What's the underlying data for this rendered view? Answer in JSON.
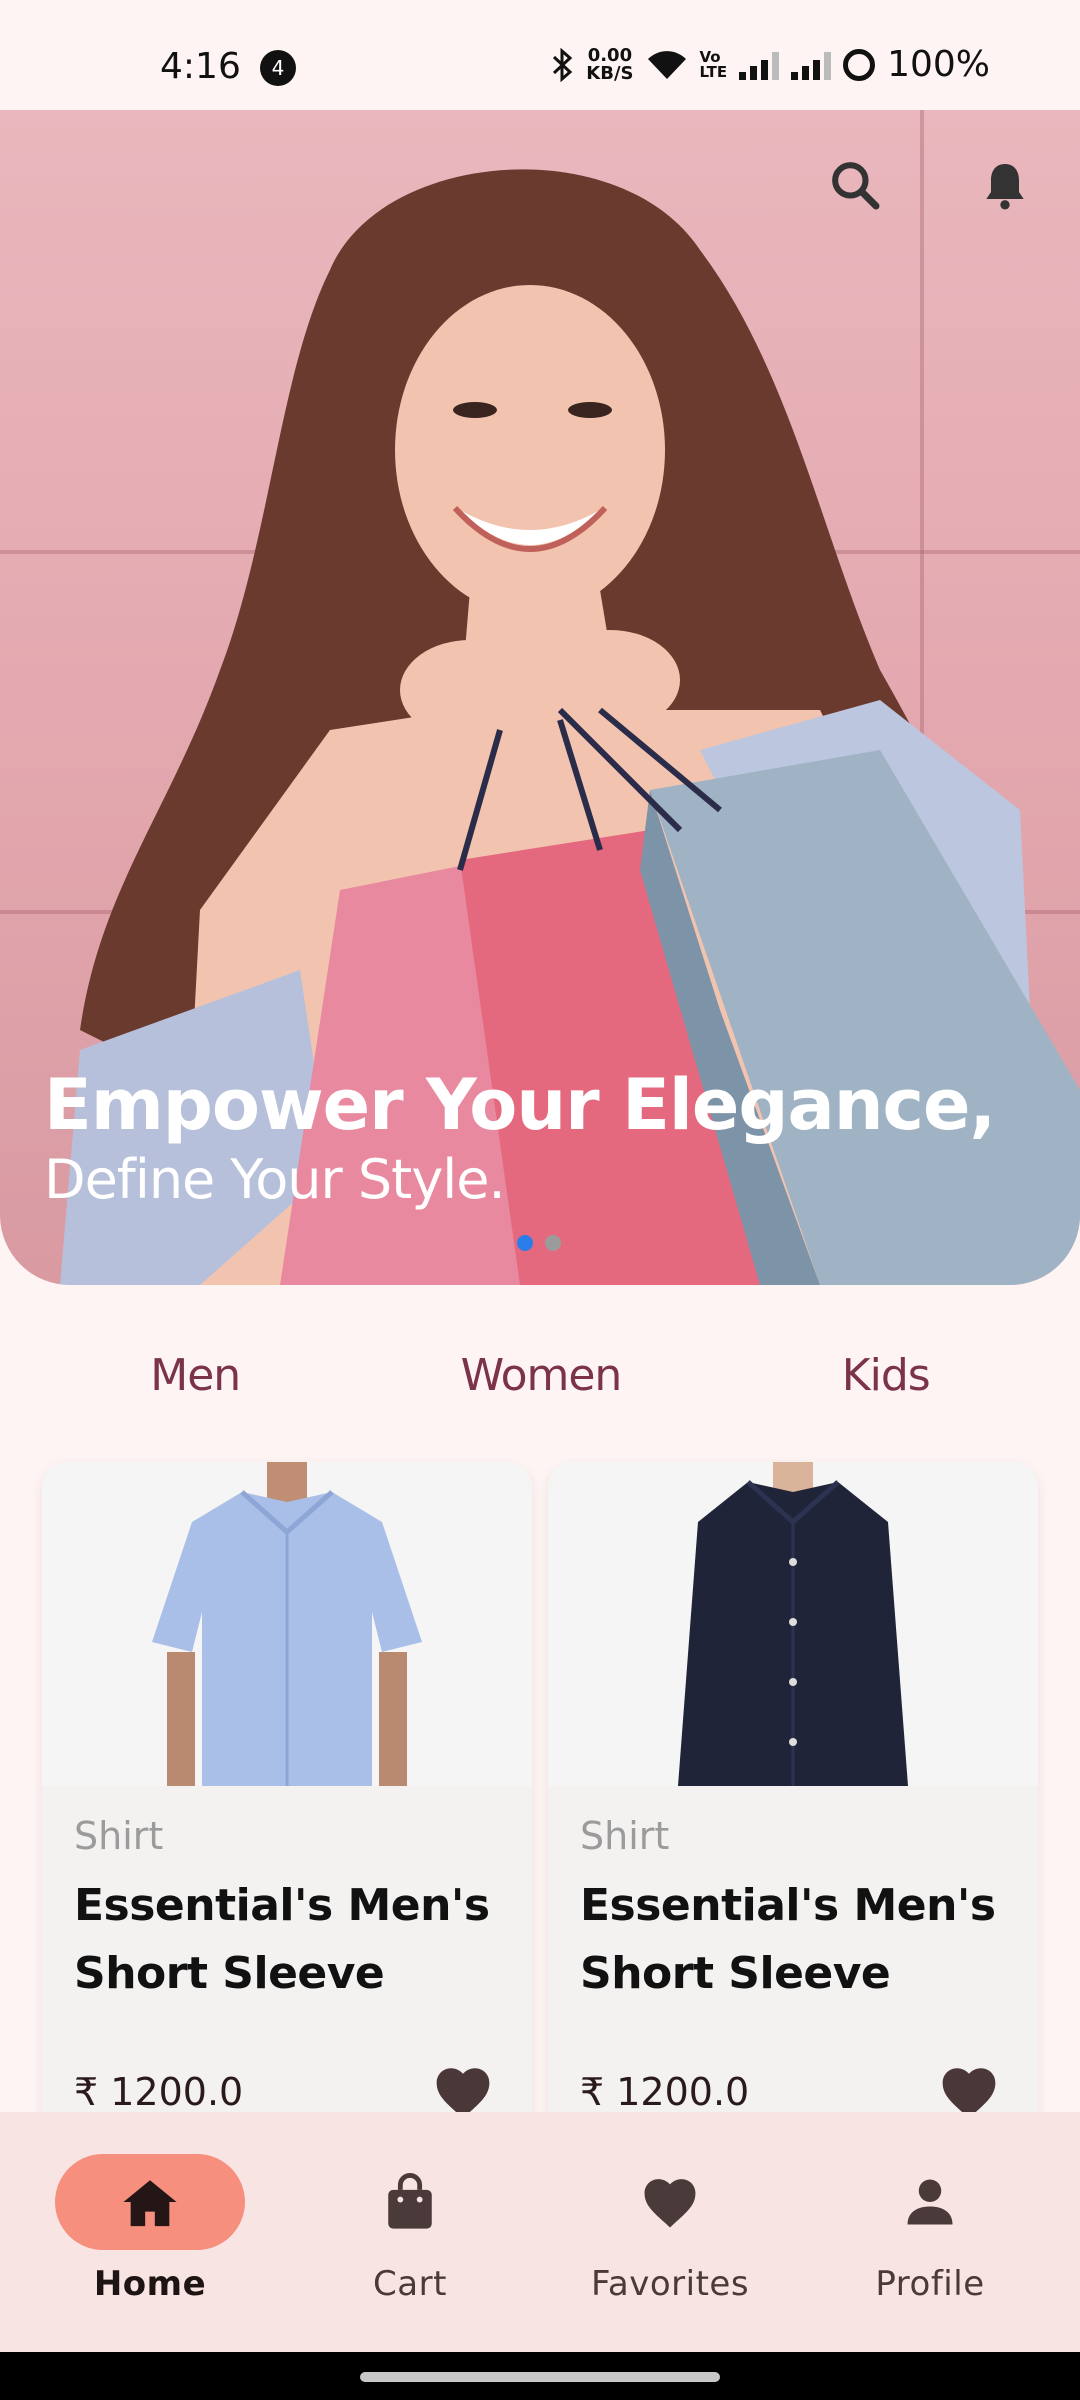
{
  "status_bar": {
    "time": "4:16",
    "notification_count": "4",
    "net_speed_value": "0.00",
    "net_speed_unit": "KB/S",
    "volte": "Vo\nLTE",
    "battery": "100%"
  },
  "hero": {
    "title": "Empower Your Elegance,",
    "subtitle": "Define Your Style.",
    "slides": 2,
    "active_slide": 1
  },
  "categories": [
    "Men",
    "Women",
    "Kids"
  ],
  "products": [
    {
      "category": "Shirt",
      "name": "Essential's Men's Short Sleeve",
      "price": "₹ 1200.0",
      "shirt_color": "#a9bfe8"
    },
    {
      "category": "Shirt",
      "name": "Essential's Men's Short Sleeve",
      "price": "₹ 1200.0",
      "shirt_color": "#1f2438"
    }
  ],
  "bottom_nav": {
    "items": [
      {
        "label": "Home",
        "icon": "home-icon"
      },
      {
        "label": "Cart",
        "icon": "shopping-bag-icon"
      },
      {
        "label": "Favorites",
        "icon": "heart-icon"
      },
      {
        "label": "Profile",
        "icon": "person-icon"
      }
    ],
    "active_index": 0
  },
  "colors": {
    "accent": "#f78f7f",
    "category_text": "#7a3348",
    "background": "#fdf4f3",
    "dot_active": "#2b7de9"
  }
}
